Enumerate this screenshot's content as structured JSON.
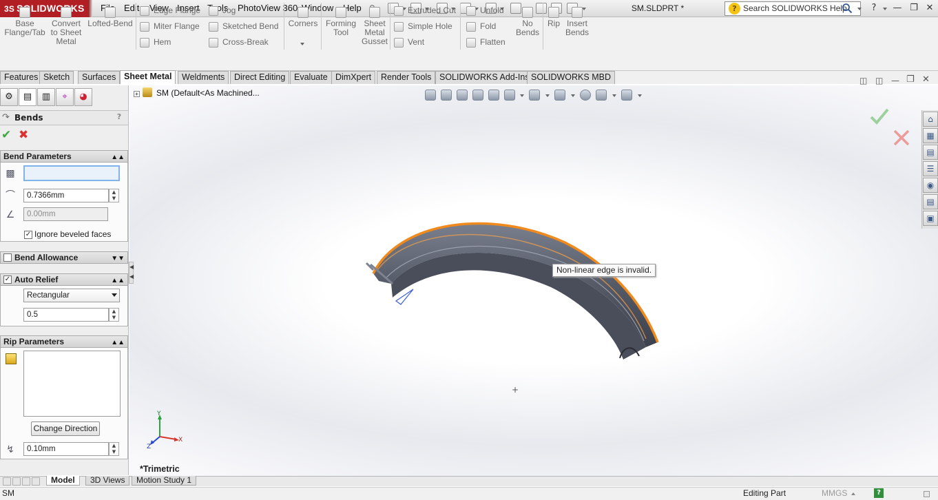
{
  "app": {
    "brand": "SOLIDWORKS",
    "brand_prefix": "3S",
    "doc_title": "SM.SLDPRT *"
  },
  "menu": [
    "File",
    "Edit",
    "View",
    "Insert",
    "Tools",
    "PhotoView 360",
    "Window",
    "Help"
  ],
  "search": {
    "placeholder": "Search SOLIDWORKS Help"
  },
  "ribbon": {
    "big": [
      {
        "l1": "Base",
        "l2": "Flange/Tab",
        "l3": ""
      },
      {
        "l1": "Convert",
        "l2": "to Sheet",
        "l3": "Metal"
      },
      {
        "l1": "Lofted-Bend",
        "l2": "",
        "l3": ""
      },
      {
        "l1": "Corners",
        "l2": "",
        "l3": ""
      },
      {
        "l1": "Forming",
        "l2": "Tool",
        "l3": ""
      },
      {
        "l1": "Sheet",
        "l2": "Metal",
        "l3": "Gusset"
      },
      {
        "l1": "No",
        "l2": "Bends",
        "l3": ""
      },
      {
        "l1": "Rip",
        "l2": "",
        "l3": ""
      },
      {
        "l1": "Insert",
        "l2": "Bends",
        "l3": ""
      }
    ],
    "col1": [
      "Edge Flange",
      "Miter Flange",
      "Hem"
    ],
    "col2": [
      "Jog",
      "Sketched Bend",
      "Cross-Break"
    ],
    "col3": [
      "Extruded Cut",
      "Simple Hole",
      "Vent"
    ],
    "col4": [
      "Unfold",
      "Fold",
      "Flatten"
    ]
  },
  "tabs": [
    "Features",
    "Sketch",
    "Surfaces",
    "Sheet Metal",
    "Weldments",
    "Direct Editing",
    "Evaluate",
    "DimXpert",
    "Render Tools",
    "SOLIDWORKS Add-Ins",
    "SOLIDWORKS MBD"
  ],
  "active_tab": "Sheet Metal",
  "panel": {
    "title": "Bends",
    "help": "?",
    "bend_params": {
      "header": "Bend Parameters",
      "edge_value": "",
      "radius": "0.7366mm",
      "thickness": "0.00mm",
      "ignore_beveled": "Ignore beveled faces",
      "ignore_beveled_checked": true
    },
    "bend_allowance": {
      "header": "Bend Allowance",
      "checked": false
    },
    "auto_relief": {
      "header": "Auto Relief",
      "checked": true,
      "type": "Rectangular",
      "ratio": "0.5"
    },
    "rip_params": {
      "header": "Rip Parameters",
      "change_direction": "Change Direction",
      "gap": "0.10mm"
    }
  },
  "viewport": {
    "tree_label": "SM  (Default<As Machined...",
    "tooltip": "Non-linear edge is invalid.",
    "view_label": "*Trimetric",
    "axis_x": "X",
    "axis_y": "Y",
    "axis_z": "Z",
    "colors": {
      "part": "#5a5f6c",
      "edge_highlight": "#f08a1d",
      "accept": "#3ea83e",
      "cancel": "#d93030",
      "brand": "#b11f24"
    }
  },
  "bottom_tabs": [
    "Model",
    "3D Views",
    "Motion Study 1"
  ],
  "status": {
    "left": "SM",
    "mode": "Editing Part",
    "units": "MMGS",
    "help": "?"
  }
}
